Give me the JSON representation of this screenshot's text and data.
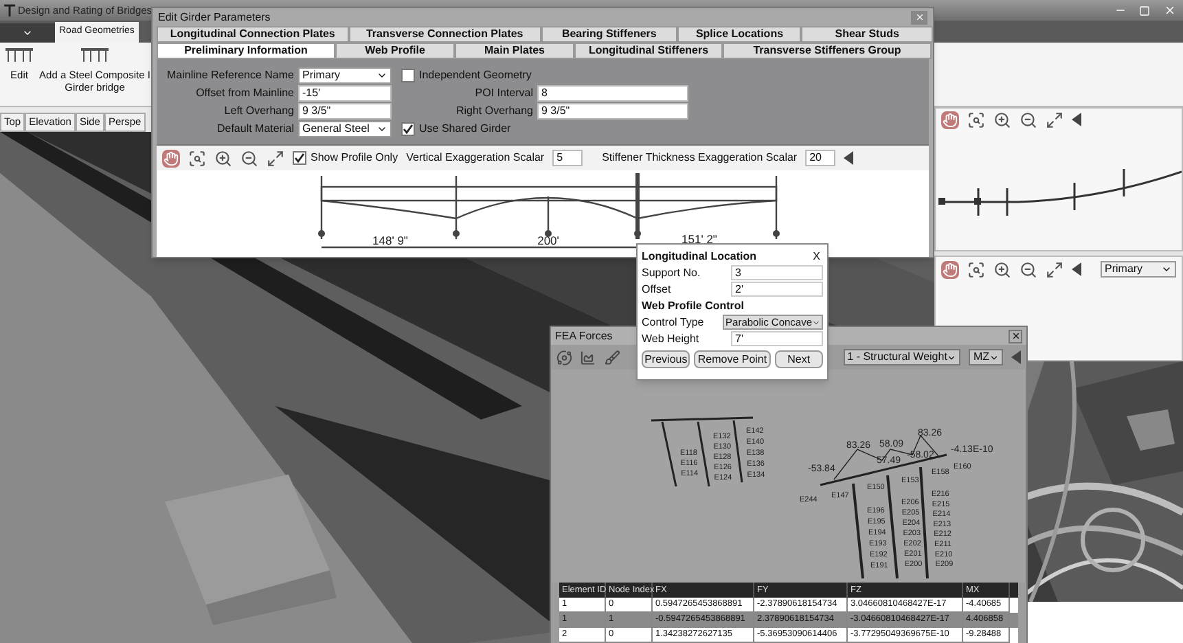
{
  "app": {
    "title": "Design and Rating of Bridges",
    "ribbon_tab": "Road Geometries",
    "ribbon_buttons": [
      {
        "label": "Edit"
      },
      {
        "label": "Add a Steel Composite I Girder bridge"
      }
    ],
    "view_tabs": [
      {
        "label": "Top",
        "selected": false
      },
      {
        "label": "Elevation",
        "selected": false
      },
      {
        "label": "Side",
        "selected": false
      },
      {
        "label": "Perspe",
        "selected": false
      }
    ]
  },
  "right_panel": {
    "dropdown": "Primary"
  },
  "dialog": {
    "title": "Edit Girder Parameters",
    "tabs_row1": [
      {
        "label": "Longitudinal Connection Plates",
        "selected": false
      },
      {
        "label": "Transverse Connection Plates",
        "selected": false
      },
      {
        "label": "Bearing Stiffeners",
        "selected": false
      },
      {
        "label": "Splice Locations",
        "selected": false
      },
      {
        "label": "Shear Studs",
        "selected": false
      }
    ],
    "tabs_row2": [
      {
        "label": "Preliminary Information",
        "selected": true
      },
      {
        "label": "Web Profile",
        "selected": false
      },
      {
        "label": "Main Plates",
        "selected": false
      },
      {
        "label": "Longitudinal Stiffeners",
        "selected": false
      },
      {
        "label": "Transverse Stiffeners Group",
        "selected": false
      }
    ],
    "left_fields": [
      {
        "kind": "select",
        "label": "Mainline Reference Name",
        "value": "Primary"
      },
      {
        "kind": "text",
        "label": "Offset from Mainline",
        "value": "-15'"
      },
      {
        "kind": "text",
        "label": "Left Overhang",
        "value": "9 3/5\""
      },
      {
        "kind": "select",
        "label": "Default Material",
        "value": "General Steel"
      }
    ],
    "right_fields": [
      {
        "kind": "checkbox",
        "label": "Independent Geometry",
        "checked": false
      },
      {
        "kind": "text",
        "label": "POI Interval",
        "value": "8"
      },
      {
        "kind": "text",
        "label": "Right Overhang",
        "value": "9 3/5\""
      },
      {
        "kind": "checkbox",
        "label": "Use Shared Girder",
        "checked": true
      }
    ],
    "toolbar": {
      "show_profile_only": {
        "label": "Show Profile Only",
        "checked": true
      },
      "vertical_label": "Vertical Exaggeration Scalar",
      "vertical_value": "5",
      "stiffener_label": "Stiffener Thickness Exaggeration Scalar",
      "stiffener_value": "20"
    },
    "profile": {
      "spans": [
        "148' 9\"",
        "200'",
        "151' 2\""
      ]
    }
  },
  "popup": {
    "title": "Longitudinal Location",
    "close": "X",
    "fields": [
      {
        "label": "Support No.",
        "value": "3"
      },
      {
        "label": "Offset",
        "value": "2'"
      }
    ],
    "section": "Web Profile Control",
    "control_type": {
      "label": "Control Type",
      "value": "Parabolic Concave"
    },
    "web_height": {
      "label": "Web Height",
      "value": "7'"
    },
    "buttons": [
      "Previous",
      "Remove Point",
      "Next"
    ]
  },
  "fea": {
    "title": "FEA Forces",
    "load_case": "1 - Structural Weight",
    "component": "MZ",
    "plot": {
      "values": [
        "83.26",
        "-53.84",
        "58.09",
        "57.49",
        "-58.02",
        "83.26",
        "-4.13E-10"
      ],
      "deck_labels": [
        "E244",
        "E147",
        "E150",
        "E153",
        "E158",
        "E160"
      ],
      "column_1": [
        "E196",
        "E195",
        "E194",
        "E193",
        "E192",
        "E191"
      ],
      "column_2": [
        "E206",
        "E205",
        "E204",
        "E203",
        "E202",
        "E201",
        "E200"
      ],
      "column_3": [
        "E216",
        "E215",
        "E214",
        "E213",
        "E212",
        "E211",
        "E210",
        "E209"
      ],
      "left_column_1": [
        "E142",
        "E140",
        "E138",
        "E136",
        "E134"
      ],
      "left_column_2": [
        "E132",
        "E130",
        "E128",
        "E126",
        "E124"
      ],
      "left_column_3": [
        "E118",
        "E116",
        "E114"
      ]
    },
    "table": {
      "columns": [
        "Element ID",
        "Node Index",
        "FX",
        "FY",
        "FZ",
        "MX"
      ],
      "rows": [
        {
          "selected": false,
          "cells": [
            "1",
            "0",
            "0.5947265453868891",
            "-2.37890618154734",
            "3.04660810468427E-17",
            "-4.40685"
          ]
        },
        {
          "selected": true,
          "cells": [
            "1",
            "1",
            "-0.5947265453868891",
            "2.37890618154734",
            "-3.04660810468427E-17",
            "4.406858"
          ]
        },
        {
          "selected": false,
          "cells": [
            "2",
            "0",
            "1.34238272627135",
            "-5.36953090614406",
            "-3.77295049369675E-10",
            "-9.28488"
          ]
        }
      ]
    }
  }
}
